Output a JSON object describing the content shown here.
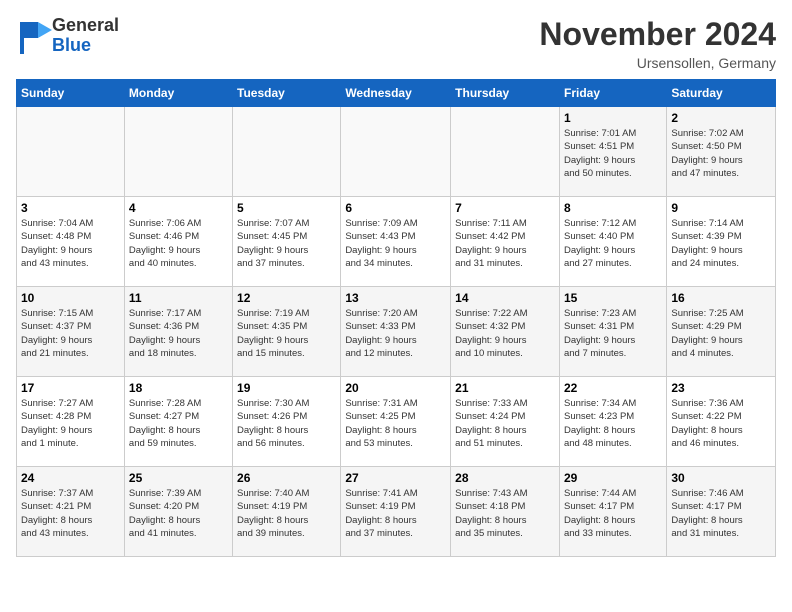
{
  "header": {
    "logo_line1": "General",
    "logo_line2": "Blue",
    "month": "November 2024",
    "location": "Ursensollen, Germany"
  },
  "days_of_week": [
    "Sunday",
    "Monday",
    "Tuesday",
    "Wednesday",
    "Thursday",
    "Friday",
    "Saturday"
  ],
  "weeks": [
    [
      {
        "day": "",
        "info": ""
      },
      {
        "day": "",
        "info": ""
      },
      {
        "day": "",
        "info": ""
      },
      {
        "day": "",
        "info": ""
      },
      {
        "day": "",
        "info": ""
      },
      {
        "day": "1",
        "info": "Sunrise: 7:01 AM\nSunset: 4:51 PM\nDaylight: 9 hours\nand 50 minutes."
      },
      {
        "day": "2",
        "info": "Sunrise: 7:02 AM\nSunset: 4:50 PM\nDaylight: 9 hours\nand 47 minutes."
      }
    ],
    [
      {
        "day": "3",
        "info": "Sunrise: 7:04 AM\nSunset: 4:48 PM\nDaylight: 9 hours\nand 43 minutes."
      },
      {
        "day": "4",
        "info": "Sunrise: 7:06 AM\nSunset: 4:46 PM\nDaylight: 9 hours\nand 40 minutes."
      },
      {
        "day": "5",
        "info": "Sunrise: 7:07 AM\nSunset: 4:45 PM\nDaylight: 9 hours\nand 37 minutes."
      },
      {
        "day": "6",
        "info": "Sunrise: 7:09 AM\nSunset: 4:43 PM\nDaylight: 9 hours\nand 34 minutes."
      },
      {
        "day": "7",
        "info": "Sunrise: 7:11 AM\nSunset: 4:42 PM\nDaylight: 9 hours\nand 31 minutes."
      },
      {
        "day": "8",
        "info": "Sunrise: 7:12 AM\nSunset: 4:40 PM\nDaylight: 9 hours\nand 27 minutes."
      },
      {
        "day": "9",
        "info": "Sunrise: 7:14 AM\nSunset: 4:39 PM\nDaylight: 9 hours\nand 24 minutes."
      }
    ],
    [
      {
        "day": "10",
        "info": "Sunrise: 7:15 AM\nSunset: 4:37 PM\nDaylight: 9 hours\nand 21 minutes."
      },
      {
        "day": "11",
        "info": "Sunrise: 7:17 AM\nSunset: 4:36 PM\nDaylight: 9 hours\nand 18 minutes."
      },
      {
        "day": "12",
        "info": "Sunrise: 7:19 AM\nSunset: 4:35 PM\nDaylight: 9 hours\nand 15 minutes."
      },
      {
        "day": "13",
        "info": "Sunrise: 7:20 AM\nSunset: 4:33 PM\nDaylight: 9 hours\nand 12 minutes."
      },
      {
        "day": "14",
        "info": "Sunrise: 7:22 AM\nSunset: 4:32 PM\nDaylight: 9 hours\nand 10 minutes."
      },
      {
        "day": "15",
        "info": "Sunrise: 7:23 AM\nSunset: 4:31 PM\nDaylight: 9 hours\nand 7 minutes."
      },
      {
        "day": "16",
        "info": "Sunrise: 7:25 AM\nSunset: 4:29 PM\nDaylight: 9 hours\nand 4 minutes."
      }
    ],
    [
      {
        "day": "17",
        "info": "Sunrise: 7:27 AM\nSunset: 4:28 PM\nDaylight: 9 hours\nand 1 minute."
      },
      {
        "day": "18",
        "info": "Sunrise: 7:28 AM\nSunset: 4:27 PM\nDaylight: 8 hours\nand 59 minutes."
      },
      {
        "day": "19",
        "info": "Sunrise: 7:30 AM\nSunset: 4:26 PM\nDaylight: 8 hours\nand 56 minutes."
      },
      {
        "day": "20",
        "info": "Sunrise: 7:31 AM\nSunset: 4:25 PM\nDaylight: 8 hours\nand 53 minutes."
      },
      {
        "day": "21",
        "info": "Sunrise: 7:33 AM\nSunset: 4:24 PM\nDaylight: 8 hours\nand 51 minutes."
      },
      {
        "day": "22",
        "info": "Sunrise: 7:34 AM\nSunset: 4:23 PM\nDaylight: 8 hours\nand 48 minutes."
      },
      {
        "day": "23",
        "info": "Sunrise: 7:36 AM\nSunset: 4:22 PM\nDaylight: 8 hours\nand 46 minutes."
      }
    ],
    [
      {
        "day": "24",
        "info": "Sunrise: 7:37 AM\nSunset: 4:21 PM\nDaylight: 8 hours\nand 43 minutes."
      },
      {
        "day": "25",
        "info": "Sunrise: 7:39 AM\nSunset: 4:20 PM\nDaylight: 8 hours\nand 41 minutes."
      },
      {
        "day": "26",
        "info": "Sunrise: 7:40 AM\nSunset: 4:19 PM\nDaylight: 8 hours\nand 39 minutes."
      },
      {
        "day": "27",
        "info": "Sunrise: 7:41 AM\nSunset: 4:19 PM\nDaylight: 8 hours\nand 37 minutes."
      },
      {
        "day": "28",
        "info": "Sunrise: 7:43 AM\nSunset: 4:18 PM\nDaylight: 8 hours\nand 35 minutes."
      },
      {
        "day": "29",
        "info": "Sunrise: 7:44 AM\nSunset: 4:17 PM\nDaylight: 8 hours\nand 33 minutes."
      },
      {
        "day": "30",
        "info": "Sunrise: 7:46 AM\nSunset: 4:17 PM\nDaylight: 8 hours\nand 31 minutes."
      }
    ]
  ]
}
